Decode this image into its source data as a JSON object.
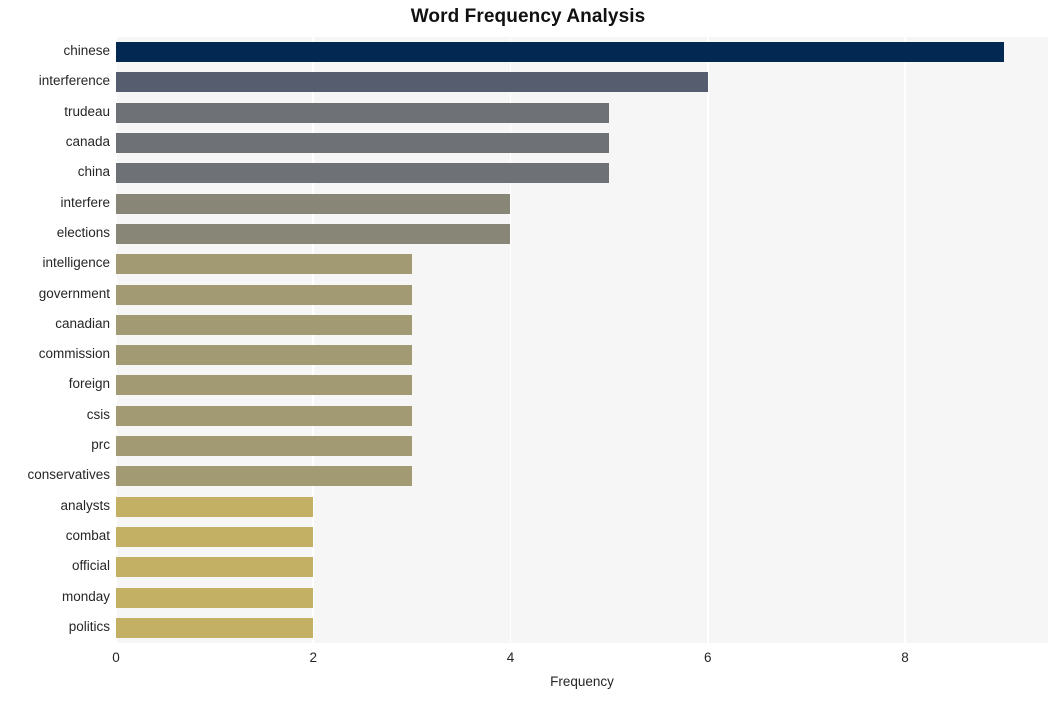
{
  "chart_data": {
    "type": "bar",
    "orientation": "horizontal",
    "title": "Word Frequency Analysis",
    "xlabel": "Frequency",
    "ylabel": "",
    "xlim": [
      0,
      9.45
    ],
    "ylim": [
      0,
      20
    ],
    "xticks": [
      "0",
      "2",
      "4",
      "6",
      "8"
    ],
    "xtick_values": [
      0,
      2,
      4,
      6,
      8
    ],
    "grid": "vertical-white-gridlines",
    "legend": "none",
    "categories": [
      "chinese",
      "interference",
      "trudeau",
      "canada",
      "china",
      "interfere",
      "elections",
      "intelligence",
      "government",
      "canadian",
      "commission",
      "foreign",
      "csis",
      "prc",
      "conservatives",
      "analysts",
      "combat",
      "official",
      "monday",
      "politics"
    ],
    "values": [
      9,
      6,
      5,
      5,
      5,
      4,
      4,
      3,
      3,
      3,
      3,
      3,
      3,
      3,
      3,
      2,
      2,
      2,
      2,
      2
    ],
    "bar_colors": [
      "#032852",
      "#565d6e",
      "#6e7175",
      "#6e7175",
      "#6e7175",
      "#888677",
      "#888676",
      "#a29a73",
      "#a29a73",
      "#a29a73",
      "#a29a73",
      "#a29a73",
      "#a29a73",
      "#a29a73",
      "#a29a73",
      "#c4b065",
      "#c4b065",
      "#c4b065",
      "#c4b065",
      "#c4b065"
    ],
    "plot_background": "#f6f6f7",
    "figure_background": "#ffffff",
    "gridline_color": "#ffffff",
    "text_color": "#262626"
  }
}
